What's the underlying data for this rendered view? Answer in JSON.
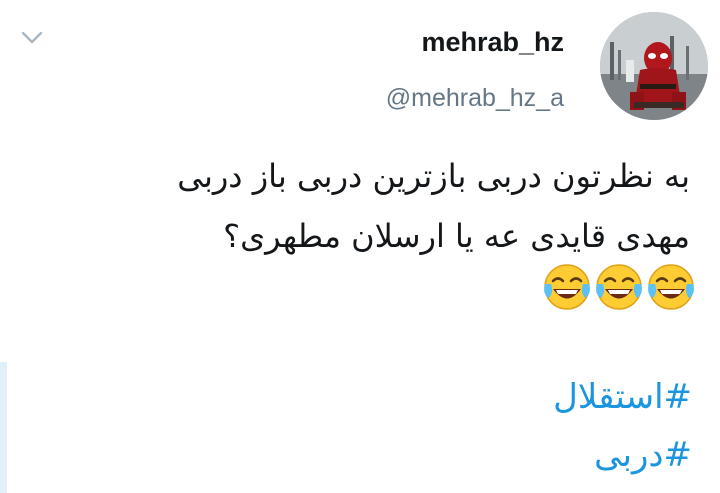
{
  "tweet": {
    "author": {
      "display_name": "mehrab_hz",
      "handle": "@mehrab_hz_a",
      "avatar_icon": "avatar-deadpool-image"
    },
    "menu_icon": "chevron-down-icon",
    "text_lines": [
      "به نظرتون دربی بازترین دربی باز دربی",
      "مهدی قایدی عه یا ارسلان مطهری؟"
    ],
    "emojis": [
      "face-with-tears-of-joy",
      "face-with-tears-of-joy",
      "face-with-tears-of-joy"
    ],
    "hashtags": [
      "#استقلال",
      "#دربی"
    ]
  },
  "colors": {
    "text": "#14171a",
    "secondary_text": "#657786",
    "link": "#1b95e0",
    "chevron": "#aab8c2"
  }
}
